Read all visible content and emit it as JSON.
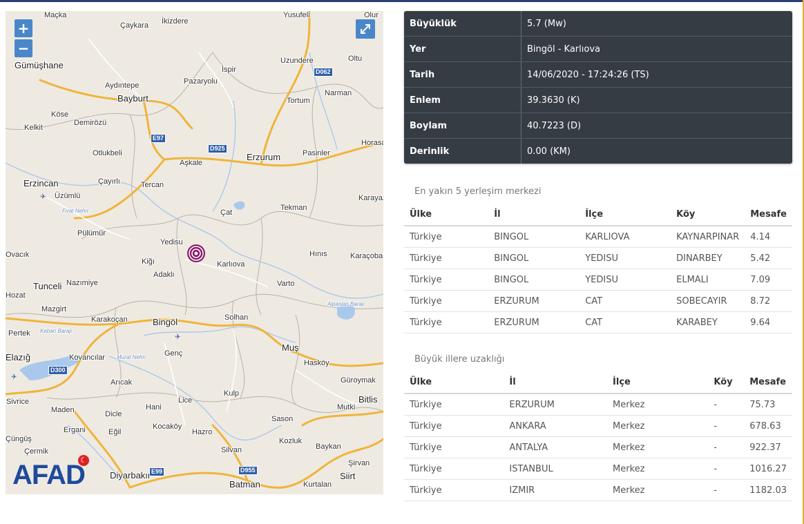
{
  "map": {
    "zoom_in_label": "+",
    "zoom_out_label": "−",
    "fullscreen_icon": "expand-arrows-icon",
    "logo_text": "AFAD",
    "colors": {
      "epicenter": "#8b1a6b",
      "road": "#f0b43a",
      "water": "#a9c8ec",
      "land": "#eeeae2"
    },
    "epicenter_marker": "concentric-circle-marker",
    "places": [
      {
        "name": "Maçka",
        "major": false
      },
      {
        "name": "Çaykara",
        "major": false
      },
      {
        "name": "İkizdere",
        "major": false
      },
      {
        "name": "Yusufeli",
        "major": false
      },
      {
        "name": "Olur",
        "major": false
      },
      {
        "name": "Gümüşhane",
        "major": true
      },
      {
        "name": "İspir",
        "major": false
      },
      {
        "name": "Uzundere",
        "major": false
      },
      {
        "name": "Oltu",
        "major": false
      },
      {
        "name": "Aydıntepe",
        "major": false
      },
      {
        "name": "Pazaryolu",
        "major": false
      },
      {
        "name": "Bayburt",
        "major": true
      },
      {
        "name": "Narman",
        "major": false
      },
      {
        "name": "Tortum",
        "major": false
      },
      {
        "name": "Köse",
        "major": false
      },
      {
        "name": "Kelkit",
        "major": false
      },
      {
        "name": "Demirözü",
        "major": false
      },
      {
        "name": "Otlukbeli",
        "major": false
      },
      {
        "name": "Horasan",
        "major": false
      },
      {
        "name": "Aşkale",
        "major": false
      },
      {
        "name": "Erzurum",
        "major": true
      },
      {
        "name": "Pasinler",
        "major": false
      },
      {
        "name": "Erzincan",
        "major": true
      },
      {
        "name": "Çayırlı",
        "major": false
      },
      {
        "name": "Tercan",
        "major": false
      },
      {
        "name": "Üzümlü",
        "major": false
      },
      {
        "name": "Karayazı",
        "major": false
      },
      {
        "name": "Fırat Nehri",
        "major": false
      },
      {
        "name": "Çat",
        "major": false
      },
      {
        "name": "Tekman",
        "major": false
      },
      {
        "name": "Pülümür",
        "major": false
      },
      {
        "name": "Yedisu",
        "major": false
      },
      {
        "name": "Hınıs",
        "major": false
      },
      {
        "name": "Karaçoban",
        "major": false
      },
      {
        "name": "Kiğı",
        "major": false
      },
      {
        "name": "Karlıova",
        "major": false
      },
      {
        "name": "Adaklı",
        "major": false
      },
      {
        "name": "Ovacık",
        "major": false
      },
      {
        "name": "Nazımiye",
        "major": false
      },
      {
        "name": "Varto",
        "major": false
      },
      {
        "name": "Tunceli",
        "major": true
      },
      {
        "name": "Pülümür",
        "major": false
      },
      {
        "name": "Hozat",
        "major": false
      },
      {
        "name": "Alpaslan Barajı",
        "major": false
      },
      {
        "name": "Mazgirt",
        "major": false
      },
      {
        "name": "Karakoçan",
        "major": false
      },
      {
        "name": "Bingöl",
        "major": true
      },
      {
        "name": "Solhan",
        "major": false
      },
      {
        "name": "Pertek",
        "major": false
      },
      {
        "name": "Keban Barajı",
        "major": false
      },
      {
        "name": "Muş",
        "major": true
      },
      {
        "name": "Elazığ",
        "major": true
      },
      {
        "name": "Kovancılar",
        "major": false
      },
      {
        "name": "Murat Nehri",
        "major": false
      },
      {
        "name": "Genç",
        "major": false
      },
      {
        "name": "Hasköy",
        "major": false
      },
      {
        "name": "Güroymak",
        "major": false
      },
      {
        "name": "Arıcak",
        "major": false
      },
      {
        "name": "Sivrice",
        "major": false
      },
      {
        "name": "Lice",
        "major": false
      },
      {
        "name": "Kulp",
        "major": false
      },
      {
        "name": "Bitlis",
        "major": true
      },
      {
        "name": "Maden",
        "major": false
      },
      {
        "name": "Hani",
        "major": false
      },
      {
        "name": "Dicle",
        "major": false
      },
      {
        "name": "Mutki",
        "major": false
      },
      {
        "name": "Sason",
        "major": false
      },
      {
        "name": "Ergani",
        "major": false
      },
      {
        "name": "Eğil",
        "major": false
      },
      {
        "name": "Kocaköy",
        "major": false
      },
      {
        "name": "Hazro",
        "major": false
      },
      {
        "name": "Çüngüş",
        "major": false
      },
      {
        "name": "Kozluk",
        "major": false
      },
      {
        "name": "Baykan",
        "major": false
      },
      {
        "name": "Çermik",
        "major": false
      },
      {
        "name": "Silvan",
        "major": false
      },
      {
        "name": "Şirvan",
        "major": false
      },
      {
        "name": "Diyarbakır",
        "major": true
      },
      {
        "name": "Siirt",
        "major": true
      },
      {
        "name": "Batman",
        "major": true
      },
      {
        "name": "Kurtalan",
        "major": false
      }
    ],
    "roads": [
      "D062",
      "E97",
      "D925",
      "D300",
      "E99",
      "D955"
    ]
  },
  "info": {
    "rows": [
      {
        "key": "Büyüklük",
        "value": "5.7 (Mw)"
      },
      {
        "key": "Yer",
        "value": "Bingöl - Karlıova"
      },
      {
        "key": "Tarih",
        "value": "14/06/2020 - 17:24:26 (TS)"
      },
      {
        "key": "Enlem",
        "value": "39.3630 (K)"
      },
      {
        "key": "Boylam",
        "value": "40.7223 (D)"
      },
      {
        "key": "Derinlik",
        "value": "0.00 (KM)"
      }
    ]
  },
  "nearest": {
    "title": "En yakın 5 yerleşim merkezi",
    "headers": [
      "Ülke",
      "İl",
      "İlçe",
      "Köy",
      "Mesafe"
    ],
    "rows": [
      [
        "Türkiye",
        "BINGOL",
        "KARLIOVA",
        "KAYNARPINAR",
        "4.14"
      ],
      [
        "Türkiye",
        "BINGOL",
        "YEDISU",
        "DINARBEY",
        "5.42"
      ],
      [
        "Türkiye",
        "BINGOL",
        "YEDISU",
        "ELMALI",
        "7.09"
      ],
      [
        "Türkiye",
        "ERZURUM",
        "CAT",
        "SOBECAYIR",
        "8.72"
      ],
      [
        "Türkiye",
        "ERZURUM",
        "CAT",
        "KARABEY",
        "9.64"
      ]
    ]
  },
  "big_cities": {
    "title": "Büyük illere uzaklığı",
    "headers": [
      "Ülke",
      "İl",
      "İlçe",
      "Köy",
      "Mesafe"
    ],
    "rows": [
      [
        "Türkiye",
        "ERZURUM",
        "Merkez",
        "-",
        "75.73"
      ],
      [
        "Türkiye",
        "ANKARA",
        "Merkez",
        "-",
        "678.63"
      ],
      [
        "Türkiye",
        "ANTALYA",
        "Merkez",
        "-",
        "922.37"
      ],
      [
        "Türkiye",
        "ISTANBUL",
        "Merkez",
        "-",
        "1016.27"
      ],
      [
        "Türkiye",
        "IZMIR",
        "Merkez",
        "-",
        "1182.03"
      ]
    ]
  }
}
